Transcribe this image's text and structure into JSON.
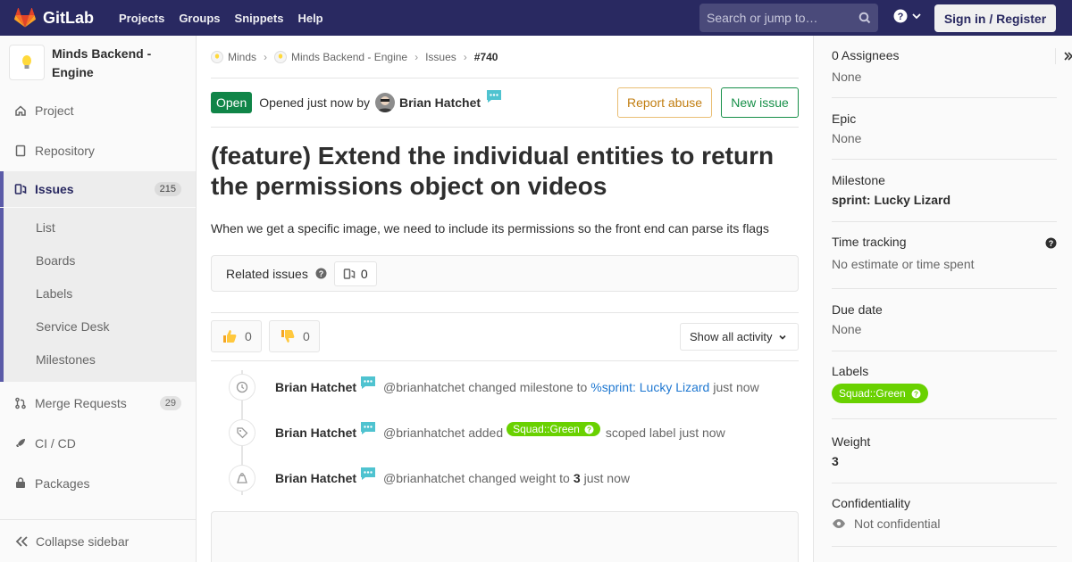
{
  "navbar": {
    "brand": "GitLab",
    "links": [
      "Projects",
      "Groups",
      "Snippets",
      "Help"
    ],
    "search_placeholder": "Search or jump to…",
    "signin": "Sign in / Register"
  },
  "sidebar": {
    "project_name": "Minds Backend - Engine",
    "items": [
      {
        "label": "Project",
        "icon": "home-icon"
      },
      {
        "label": "Repository",
        "icon": "doc-icon"
      },
      {
        "label": "Issues",
        "icon": "issues-icon",
        "count": "215"
      },
      {
        "label": "Merge Requests",
        "icon": "merge-icon",
        "count": "29"
      },
      {
        "label": "CI / CD",
        "icon": "rocket-icon"
      },
      {
        "label": "Packages",
        "icon": "package-icon"
      }
    ],
    "sub_items": [
      "List",
      "Boards",
      "Labels",
      "Service Desk",
      "Milestones"
    ],
    "collapse_label": "Collapse sidebar"
  },
  "breadcrumbs": [
    "Minds",
    "Minds Backend - Engine",
    "Issues",
    "#740"
  ],
  "issue": {
    "status": "Open",
    "opened_text": "Opened just now by",
    "author": "Brian Hatchet",
    "report_abuse": "Report abuse",
    "new_issue": "New issue",
    "title": "(feature) Extend the individual entities to return the permissions object on videos",
    "description": "When we get a specific image, we need to include its permissions so the front end can parse its flags",
    "related_label": "Related issues",
    "related_count": "0",
    "thumbs_up": "0",
    "thumbs_down": "0",
    "activity_filter": "Show all activity"
  },
  "notes": [
    {
      "author": "Brian Hatchet",
      "text_before": "@brianhatchet changed milestone to",
      "link": "%sprint: Lucky Lizard",
      "text_after": "just now",
      "icon": "clock-icon"
    },
    {
      "author": "Brian Hatchet",
      "text_before": "@brianhatchet added",
      "label": "Squad::Green",
      "text_after": "scoped label just now",
      "icon": "tag-icon"
    },
    {
      "author": "Brian Hatchet",
      "text_before": "@brianhatchet changed weight to",
      "value": "3",
      "text_after": "just now",
      "icon": "weight-icon"
    }
  ],
  "right_sidebar": {
    "assignees_title": "0 Assignees",
    "assignees_value": "None",
    "epic_title": "Epic",
    "epic_value": "None",
    "milestone_title": "Milestone",
    "milestone_value": "sprint: Lucky Lizard",
    "time_title": "Time tracking",
    "time_value": "No estimate or time spent",
    "due_title": "Due date",
    "due_value": "None",
    "labels_title": "Labels",
    "label_value": "Squad::Green",
    "weight_title": "Weight",
    "weight_value": "3",
    "conf_title": "Confidentiality",
    "conf_value": "Not confidential"
  },
  "colors": {
    "navbar": "#292961",
    "open_badge": "#108548",
    "label_green": "#69d100",
    "link": "#1f78d1"
  }
}
